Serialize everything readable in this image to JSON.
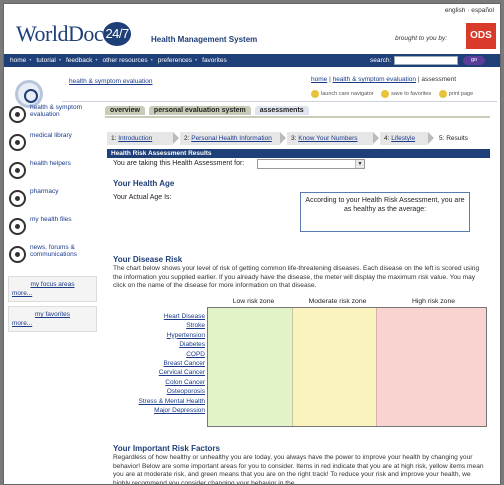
{
  "header": {
    "lang_english": "english",
    "lang_sep": "·",
    "lang_espanol": "español",
    "logo_text": "WorldDoc",
    "logo_badge": "24/7",
    "subtitle": "Health Management System",
    "brought_by": "brought to you by:",
    "sponsor": "ODS"
  },
  "nav": {
    "items": [
      "home",
      "tutorial",
      "feedback",
      "other resources",
      "preferences",
      "favorites"
    ],
    "search_label": "search:",
    "search_value": "",
    "go_label": "go"
  },
  "top": {
    "section_link": "health & symptom evaluation",
    "breadcrumb": [
      "home",
      "health & symptom evaluation",
      "assessment"
    ],
    "tools": [
      "launch care navigator",
      "save to favorites",
      "print page"
    ]
  },
  "sidebar": {
    "items": [
      "health & symptom evaluation",
      "medical library",
      "health helpers",
      "pharmacy",
      "my health files",
      "news, forums & communications"
    ],
    "focus_title": "my focus areas",
    "focus_more": "more...",
    "favorites_title": "my favorites",
    "favorites_more": "more..."
  },
  "tabs": [
    "overview",
    "personal evaluation system",
    "assessments"
  ],
  "steps": [
    {
      "num": "1:",
      "label": "Introduction"
    },
    {
      "num": "2:",
      "label": "Personal Health Information"
    },
    {
      "num": "3:",
      "label": "Know Your Numbers"
    },
    {
      "num": "4:",
      "label": "Lifestyle"
    },
    {
      "num": "5:",
      "label": "Results"
    }
  ],
  "results": {
    "bar_title": "Health Risk Assessment Results",
    "taking_label": "You are taking this Health Assessment for:",
    "taking_value": "",
    "age_title": "Your Health Age",
    "actual_age_label": "Your Actual Age Is:",
    "age_message": "According to your Health Risk Assessment, you are as healthy as the average:",
    "disease_title": "Your Disease Risk",
    "disease_text": "The chart below shows your level of risk of getting common life-threatening diseases. Each disease on the left is scored using the information you supplied earlier. If you already have the disease, the meter will display the maximum risk value. You may click on the name of the disease for more information on that disease.",
    "zones": [
      "Low risk zone",
      "Moderate risk zone",
      "High risk zone"
    ],
    "diseases": [
      "Heart Disease",
      "Stroke",
      "Hypertension",
      "Diabetes",
      "COPD",
      "Breast Cancer",
      "Cervical Cancer",
      "Colon Cancer",
      "Osteoporosis",
      "Stress & Mental Health",
      "Major Depression"
    ],
    "risk_title": "Your Important Risk Factors",
    "risk_text": "Regardless of how healthy or unhealthy you are today, you always have the power to improve your health by changing your behavior! Below are some important areas for you to consider. Items in red indicate that you are at high risk, yellow items mean you are at moderate risk, and green means that you are on the right track! To reduce your risk and improve your health, we highly recommend you consider changing your behavior in the"
  }
}
